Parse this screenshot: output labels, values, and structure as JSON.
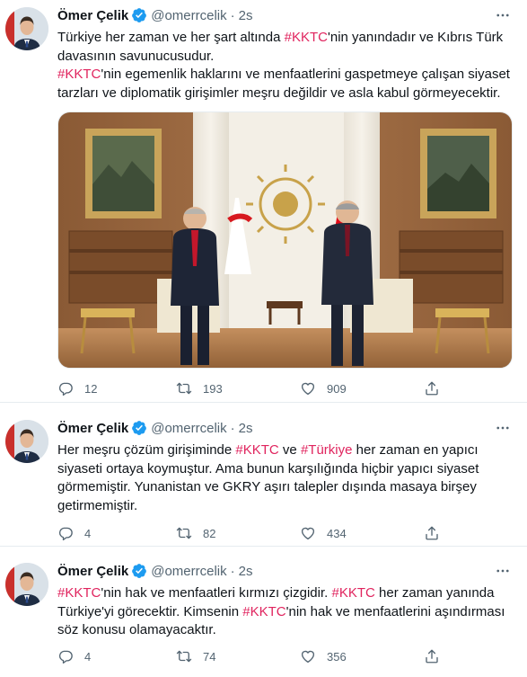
{
  "tweets": [
    {
      "author": {
        "name": "Ömer Çelik",
        "handle": "@omerrcelik",
        "time": "2s"
      },
      "paragraphs": [
        [
          {
            "t": "Türkiye her zaman ve her şart altında "
          },
          {
            "t": "#KKTC",
            "tag": true
          },
          {
            "t": "'nin yanındadır ve Kıbrıs Türk davasının savunucusudur."
          }
        ],
        [
          {
            "t": "#KKTC",
            "tag": true
          },
          {
            "t": "'nin egemenlik haklarını ve menfaatlerini gaspetmeye çalışan siyaset tarzları ve diplomatik girişimler meşru değildir ve asla kabul görmeyecektir."
          }
        ]
      ],
      "has_photo": true,
      "stats": {
        "replies": "12",
        "retweets": "193",
        "likes": "909"
      }
    },
    {
      "author": {
        "name": "Ömer Çelik",
        "handle": "@omerrcelik",
        "time": "2s"
      },
      "paragraphs": [
        [
          {
            "t": "Her meşru çözüm girişiminde "
          },
          {
            "t": "#KKTC",
            "tag": true
          },
          {
            "t": " ve "
          },
          {
            "t": "#Türkiye",
            "tag": true
          },
          {
            "t": " her zaman en yapıcı siyaseti ortaya koymuştur. Ama bunun karşılığında hiçbir yapıcı siyaset görmemiştir. Yunanistan ve GKRY aşırı talepler dışında masaya birşey getirmemiştir."
          }
        ]
      ],
      "has_photo": false,
      "stats": {
        "replies": "4",
        "retweets": "82",
        "likes": "434"
      }
    },
    {
      "author": {
        "name": "Ömer Çelik",
        "handle": "@omerrcelik",
        "time": "2s"
      },
      "paragraphs": [
        [
          {
            "t": "#KKTC",
            "tag": true
          },
          {
            "t": "'nin hak ve menfaatleri kırmızı çizgidir. "
          },
          {
            "t": "#KKTC",
            "tag": true
          },
          {
            "t": " her zaman yanında Türkiye'yi görecektir. Kimsenin "
          },
          {
            "t": "#KKTC",
            "tag": true
          },
          {
            "t": "'nin hak ve menfaatlerini aşındırması söz konusu olamayacaktır."
          }
        ]
      ],
      "has_photo": false,
      "stats": {
        "replies": "4",
        "retweets": "74",
        "likes": "356"
      }
    }
  ],
  "colors": {
    "hashtag": "#e0245e",
    "verified": "#1d9bf0",
    "muted": "#536471"
  },
  "icons": [
    "reply-icon",
    "retweet-icon",
    "like-icon",
    "share-icon",
    "verified-badge-icon",
    "more-options-icon"
  ]
}
